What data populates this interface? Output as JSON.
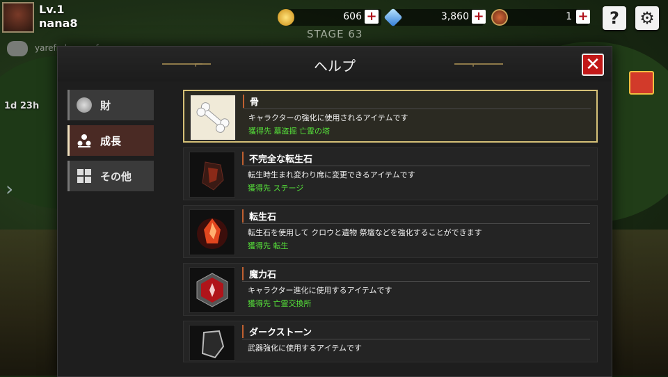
{
  "hud": {
    "level": "Lv.1",
    "player_name": "nana8",
    "stage": "STAGE 63",
    "gold": "606",
    "gems": "3,860",
    "medals": "1",
    "help_label": "?",
    "chat_text": "yarefroly : gnofear",
    "timer": "1d 23h"
  },
  "dialog": {
    "title": "ヘルプ",
    "close_label": "✕",
    "categories": [
      {
        "label": "財",
        "icon": "coin-icon",
        "active": false
      },
      {
        "label": "成長",
        "icon": "growth-icon",
        "active": true
      },
      {
        "label": "その他",
        "icon": "grid-icon",
        "active": false
      }
    ],
    "items": [
      {
        "name": "骨",
        "description": "キャラクターの強化に使用されるアイテムです",
        "source": "獲得先 墓盗掘 亡霊の塔",
        "icon": "bone-icon",
        "selected": true
      },
      {
        "name": "不完全な転生石",
        "description": "転生時生まれ変わり席に変更できるアイテムです",
        "source": "獲得先 ステージ",
        "icon": "broken-stone-icon",
        "selected": false
      },
      {
        "name": "転生石",
        "description": "転生石を使用して クロウと遺物 祭壇などを強化することができます",
        "source": "獲得先 転生",
        "icon": "rebirth-stone-icon",
        "selected": false
      },
      {
        "name": "魔力石",
        "description": "キャラクター進化に使用するアイテムです",
        "source": "獲得先 亡霊交換所",
        "icon": "magic-stone-icon",
        "selected": false
      },
      {
        "name": "ダークストーン",
        "description": "武器強化に使用するアイテムです",
        "source": "",
        "icon": "dark-stone-icon",
        "selected": false
      }
    ]
  },
  "colors": {
    "accent_gold": "#d6c178",
    "source_green": "#56e23a",
    "close_red": "#c21818",
    "active_tab": "#4a2a24"
  }
}
